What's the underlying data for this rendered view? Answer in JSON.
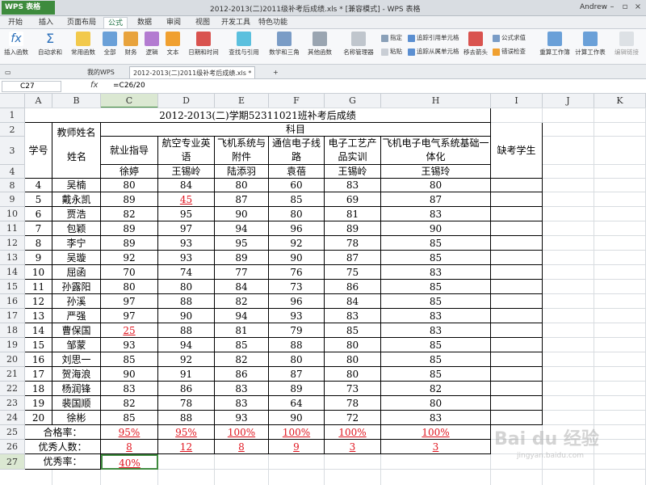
{
  "app": {
    "name": "WPS 表格",
    "window_title": "2012-2013(二)2011级补考后成绩.xls * [兼容模式] - WPS 表格",
    "user": "Andrew"
  },
  "menu": [
    "开始",
    "插入",
    "页面布局",
    "公式",
    "数据",
    "审阅",
    "视图",
    "开发工具",
    "特色功能"
  ],
  "active_menu": "公式",
  "ribbon": {
    "insert_func": "插入函数",
    "autosum": "自动求和",
    "common": "常用函数",
    "all": "全部",
    "finance": "财务",
    "logic": "逻辑",
    "text": "文本",
    "datetime": "日期和时间",
    "lookup": "查找与引用",
    "math": "数学和三角",
    "other": "其他函数",
    "name_mgr": "名称管理器",
    "specify": "指定",
    "paste": "粘贴",
    "trace_prec": "追踪引用单元格",
    "trace_dep": "追踪从属单元格",
    "remove_arrows": "移去箭头",
    "show_formula": "公式求值",
    "error_check": "错误检查",
    "recalc_wb": "重算工作簿",
    "calc_ws": "计算工作表",
    "edit_link": "编辑链接"
  },
  "tabs": {
    "wps": "我的WPS",
    "file": "2012-2013(二)2011级补考后成绩.xls *",
    "plus": "+"
  },
  "formula_bar": {
    "cell": "C27",
    "fx": "fx",
    "formula": "=C26/20"
  },
  "columns": [
    "A",
    "B",
    "C",
    "D",
    "E",
    "F",
    "G",
    "H",
    "I",
    "J",
    "K"
  ],
  "rows": [
    "1",
    "2",
    "3",
    "4",
    "8",
    "9",
    "10",
    "11",
    "12",
    "13",
    "14",
    "15",
    "16",
    "17",
    "18",
    "19",
    "20",
    "21",
    "22",
    "23",
    "24",
    "25",
    "26",
    "27"
  ],
  "sheet": {
    "title": "2012-2013(二)学期52311021班补考后成绩",
    "subject_header": "科目",
    "student_id": "学号",
    "teacher_name_header": "教师姓名",
    "name_header": "姓名",
    "subjects": [
      "就业指导",
      "航空专业英语",
      "飞机系统与附件",
      "通信电子线路",
      "电子工艺产品实训",
      "飞机电子电气系统基础一体化"
    ],
    "teachers": [
      "徐婷",
      "王锡岭",
      "陆添羽",
      "袁蓓",
      "王锡岭",
      "王锡玲"
    ],
    "absent_header": "缺考学生",
    "students": [
      {
        "id": "4",
        "name": "吴楠",
        "s": [
          "80",
          "84",
          "80",
          "60",
          "83",
          "80"
        ]
      },
      {
        "id": "5",
        "name": "戴永凯",
        "s": [
          "89",
          "45",
          "87",
          "85",
          "69",
          "87"
        ]
      },
      {
        "id": "6",
        "name": "贾浩",
        "s": [
          "82",
          "95",
          "90",
          "80",
          "81",
          "83"
        ]
      },
      {
        "id": "7",
        "name": "包颖",
        "s": [
          "89",
          "97",
          "94",
          "96",
          "89",
          "90"
        ]
      },
      {
        "id": "8",
        "name": "李宁",
        "s": [
          "89",
          "93",
          "95",
          "92",
          "78",
          "85"
        ]
      },
      {
        "id": "9",
        "name": "吴璇",
        "s": [
          "92",
          "93",
          "89",
          "90",
          "87",
          "85"
        ]
      },
      {
        "id": "10",
        "name": "屈函",
        "s": [
          "70",
          "74",
          "77",
          "76",
          "75",
          "83"
        ]
      },
      {
        "id": "11",
        "name": "孙露阳",
        "s": [
          "80",
          "80",
          "84",
          "73",
          "86",
          "85"
        ]
      },
      {
        "id": "12",
        "name": "孙溪",
        "s": [
          "97",
          "88",
          "82",
          "96",
          "84",
          "85"
        ]
      },
      {
        "id": "13",
        "name": "严强",
        "s": [
          "97",
          "90",
          "94",
          "93",
          "83",
          "83"
        ]
      },
      {
        "id": "14",
        "name": "曹保国",
        "s": [
          "25",
          "88",
          "81",
          "79",
          "85",
          "83"
        ]
      },
      {
        "id": "15",
        "name": "邹蒙",
        "s": [
          "93",
          "94",
          "85",
          "88",
          "80",
          "85"
        ]
      },
      {
        "id": "16",
        "name": "刘思一",
        "s": [
          "85",
          "92",
          "82",
          "80",
          "80",
          "85"
        ]
      },
      {
        "id": "17",
        "name": "贺海浪",
        "s": [
          "90",
          "91",
          "86",
          "87",
          "80",
          "85"
        ]
      },
      {
        "id": "18",
        "name": "杨润锋",
        "s": [
          "83",
          "86",
          "83",
          "89",
          "73",
          "82"
        ]
      },
      {
        "id": "19",
        "name": "裴国顺",
        "s": [
          "82",
          "78",
          "83",
          "64",
          "78",
          "80"
        ]
      },
      {
        "id": "20",
        "name": "徐彬",
        "s": [
          "85",
          "88",
          "93",
          "90",
          "72",
          "83"
        ]
      }
    ],
    "pass_rate_label": "合格率：",
    "pass_rates": [
      "95%",
      "95%",
      "100%",
      "100%",
      "100%",
      "100%"
    ],
    "excellent_count_label": "优秀人数：",
    "excellent_counts": [
      "8",
      "12",
      "8",
      "9",
      "3",
      "3"
    ],
    "excellent_rate_label": "优秀率：",
    "excellent_rate": "40%"
  },
  "watermark": {
    "main": "Bai du 经验",
    "sub": "jingyan.baidu.com"
  },
  "colors": {
    "accent": "#3f8a3f",
    "fail_red": "#e0141e"
  }
}
